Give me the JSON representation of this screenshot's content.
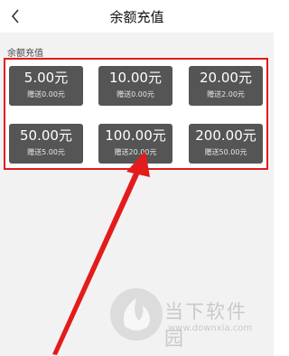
{
  "header": {
    "title": "余额充值",
    "back_icon": "chevron-left-icon"
  },
  "section": {
    "label": "余额充值"
  },
  "options": [
    {
      "amount": "5.00元",
      "bonus": "赠送0.00元"
    },
    {
      "amount": "10.00元",
      "bonus": "赠送0.00元"
    },
    {
      "amount": "20.00元",
      "bonus": "赠送2.00元"
    },
    {
      "amount": "50.00元",
      "bonus": "赠送5.00元"
    },
    {
      "amount": "100.00元",
      "bonus": "赠送20.00元"
    },
    {
      "amount": "200.00元",
      "bonus": "赠送50.00元"
    }
  ],
  "watermark": {
    "name": "当下软件园",
    "url": "www.downxia.com"
  },
  "colors": {
    "card": "#555555",
    "highlight": "#e31b1b",
    "background": "#f2f2f2"
  }
}
